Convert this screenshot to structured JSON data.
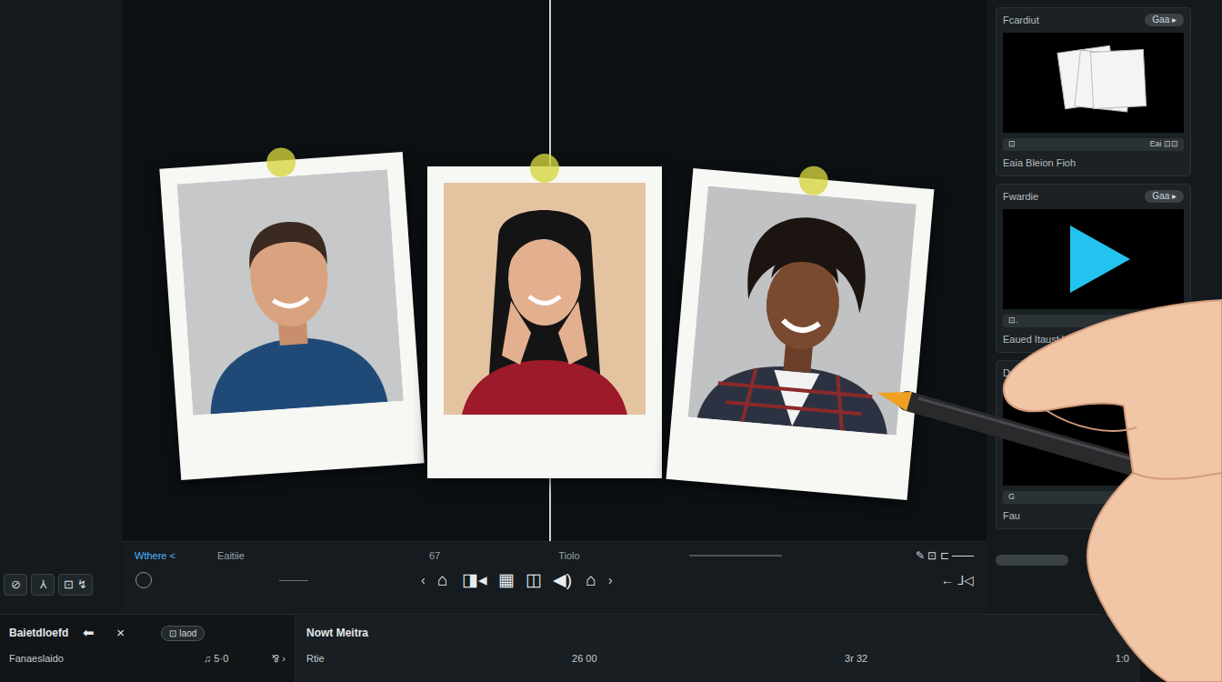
{
  "rail": {
    "icons": [
      "⊘",
      "⅄",
      "⊡ ↯"
    ]
  },
  "toolbar": {
    "tabs": [
      {
        "label": "Wthere <",
        "selected": true
      },
      {
        "label": "Eaitiie",
        "selected": false
      }
    ],
    "counter": "67",
    "title": "Tiolo",
    "right_tools": "✎ ⊡ ⊏ ——",
    "prev": "‹",
    "next": "›",
    "tools": [
      "⌂",
      "◨◂",
      "▦",
      "◫",
      "◀)",
      "⌂"
    ],
    "right_nav": "← ⅃◁"
  },
  "panels": [
    {
      "title": "Fcardiut",
      "action": "Gaa ▸",
      "meta": "⊡",
      "meta_right": "Eai ⊡⊡",
      "caption": "Eaia Bleion Fioh",
      "kind": "frame"
    },
    {
      "title": "Fwardie",
      "action": "Gaa ▸",
      "meta": "⊡.",
      "meta_right": "",
      "caption": "Eaued Itaust Vion",
      "kind": "video"
    },
    {
      "title": "Dvai",
      "meta": "G",
      "meta_right": "",
      "caption": "Fau",
      "kind": "blank"
    }
  ],
  "bottom": {
    "left": {
      "title": "Baietdloefd",
      "back": "⬅",
      "close": "×",
      "chip": "⊡ Iaod",
      "label": "Fanaeslaido",
      "time": "♫ 5·0",
      "end": "⅋ ›"
    },
    "right": {
      "title": "Nowt Meitra",
      "label": "Rtie",
      "times": [
        "26 00",
        "3r 32",
        "1:0"
      ]
    }
  }
}
